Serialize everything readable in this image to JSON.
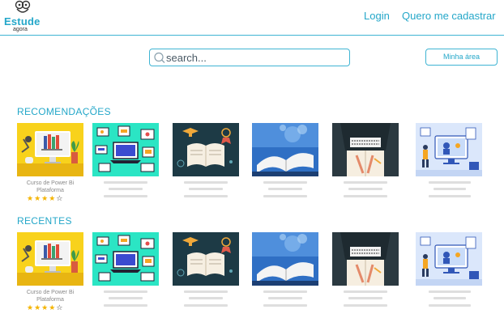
{
  "header": {
    "logo_title": "Estude",
    "logo_subtitle": "agora",
    "login": "Login",
    "signup": "Quero me cadastrar"
  },
  "search": {
    "placeholder": "search...",
    "value": ""
  },
  "area_button": "Minha área",
  "sections": [
    {
      "title": "RECOMENDAÇÕES",
      "cards": [
        {
          "title": "Curso de Power Bi Plataforma",
          "rating": 4,
          "max_rating": 5,
          "image": "power-bi-illustration"
        },
        {
          "title": "",
          "image": "online-learning-illustration"
        },
        {
          "title": "",
          "image": "graduation-book-illustration"
        },
        {
          "title": "",
          "image": "digital-book-illustration"
        },
        {
          "title": "",
          "image": "laptop-book-illustration"
        },
        {
          "title": "",
          "image": "video-class-illustration"
        }
      ]
    },
    {
      "title": "RECENTES",
      "cards": [
        {
          "title": "Curso de Power Bi Plataforma",
          "rating": 4,
          "max_rating": 5,
          "image": "power-bi-illustration"
        },
        {
          "title": "",
          "image": "online-learning-illustration"
        },
        {
          "title": "",
          "image": "graduation-book-illustration"
        },
        {
          "title": "",
          "image": "digital-book-illustration"
        },
        {
          "title": "",
          "image": "laptop-book-illustration"
        },
        {
          "title": "",
          "image": "video-class-illustration"
        }
      ]
    }
  ],
  "colors": {
    "accent": "#24a7c9",
    "star": "#f4b400",
    "placeholder_bar": "#dedede"
  }
}
